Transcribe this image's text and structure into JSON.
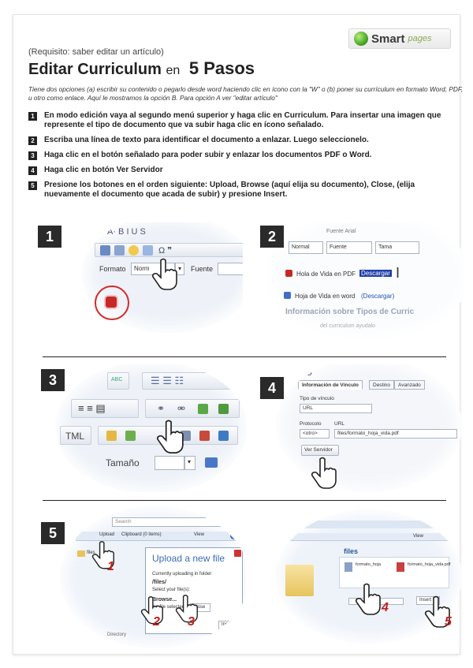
{
  "header": {
    "logo_main": "Smart",
    "logo_sub": "pages",
    "requirement": "(Requisito: saber editar un artículo)",
    "title_main": "Editar Curriculum",
    "title_en": "en",
    "title_steps": "5 Pasos",
    "intro": "Tiene dos opciones (a) escribir su contenido o pegarlo desde word haciendo clic en ícono con la \"W\" o (b) poner su currículum en formato Word, PDF, u otro como enlace. Aquí le mostramos la opción B. Para opción A ver \"editar artículo\""
  },
  "steps": [
    {
      "num": "1",
      "text": "En modo edición vaya al segundo menú superior y haga clic en Curriculum. Para insertar una imagen que represente el tipo de documento que va subir haga clic en ícono señalado."
    },
    {
      "num": "2",
      "text": "Escriba una línea de texto para identificar el documento a enlazar. Luego seleccionelo."
    },
    {
      "num": "3",
      "text": "Haga clic en el botón señalado para poder subir y enlazar los documentos PDF o Word."
    },
    {
      "num": "4",
      "text": "Haga clic en botón Ver Servidor"
    },
    {
      "num": "5",
      "text": "Presione los botones en el orden siguiente: Upload, Browse (aquí elija su documento), Close, (elija nuevamente el documento que acada de subir) y presione Insert."
    }
  ],
  "panels": {
    "p1": {
      "badge": "1",
      "format_label": "Formato",
      "format_value": "Norm",
      "font_label": "Fuente"
    },
    "p2": {
      "badge": "2",
      "toolbar_text": "Fuente Arial",
      "format_value": "Normal",
      "font_value": "Fuente",
      "size_value": "Tama",
      "line1_text": "Hola de Vida en PDF",
      "line1_link": "Descargar",
      "line2_text": "Hoja de Vida en word",
      "line2_link": "(Descargar)",
      "heading": "Información sobre Tipos de Curric",
      "faint": "del curriculum ayudalo"
    },
    "p3": {
      "badge": "3",
      "html_label": "TML",
      "size_label": "Tamaño"
    },
    "p4": {
      "badge": "4",
      "dialog_title": "culo",
      "tab_info": "Información de Vínculo",
      "tab_dest": "Destino",
      "tab_adv": "Avanzado",
      "type_label": "Tipo de vínculo",
      "type_value": "URL",
      "protocol_label": "Protocolo",
      "protocol_value": "<otro>",
      "url_label": "URL",
      "url_value": "files/formato_hoja_vida.pdf",
      "server_button": "Ver Servidor"
    },
    "p5": {
      "badge": "5",
      "search": "Search",
      "nav_files": "files",
      "nav_upload": "Upload",
      "nav_clipboard": "Clipboard (0 items)",
      "nav_view": "View",
      "upload_title": "Upload a new file",
      "upload_line1": "Currently uploading in folder:",
      "upload_folder": "/files/",
      "upload_line2": "Select your file(s):",
      "browse": "Browse...",
      "nofile": "No file selected",
      "close": "Close",
      "insert": "Insert",
      "dir": "Directory",
      "n1": "1",
      "n2": "2",
      "n3": "3"
    },
    "p6": {
      "files_heading": "files",
      "toolbar": "View",
      "file1": "formato_hoja",
      "file2": "formato_hoja_vida.pdf",
      "insert": "Insert",
      "n4": "4",
      "n5": "5"
    }
  }
}
